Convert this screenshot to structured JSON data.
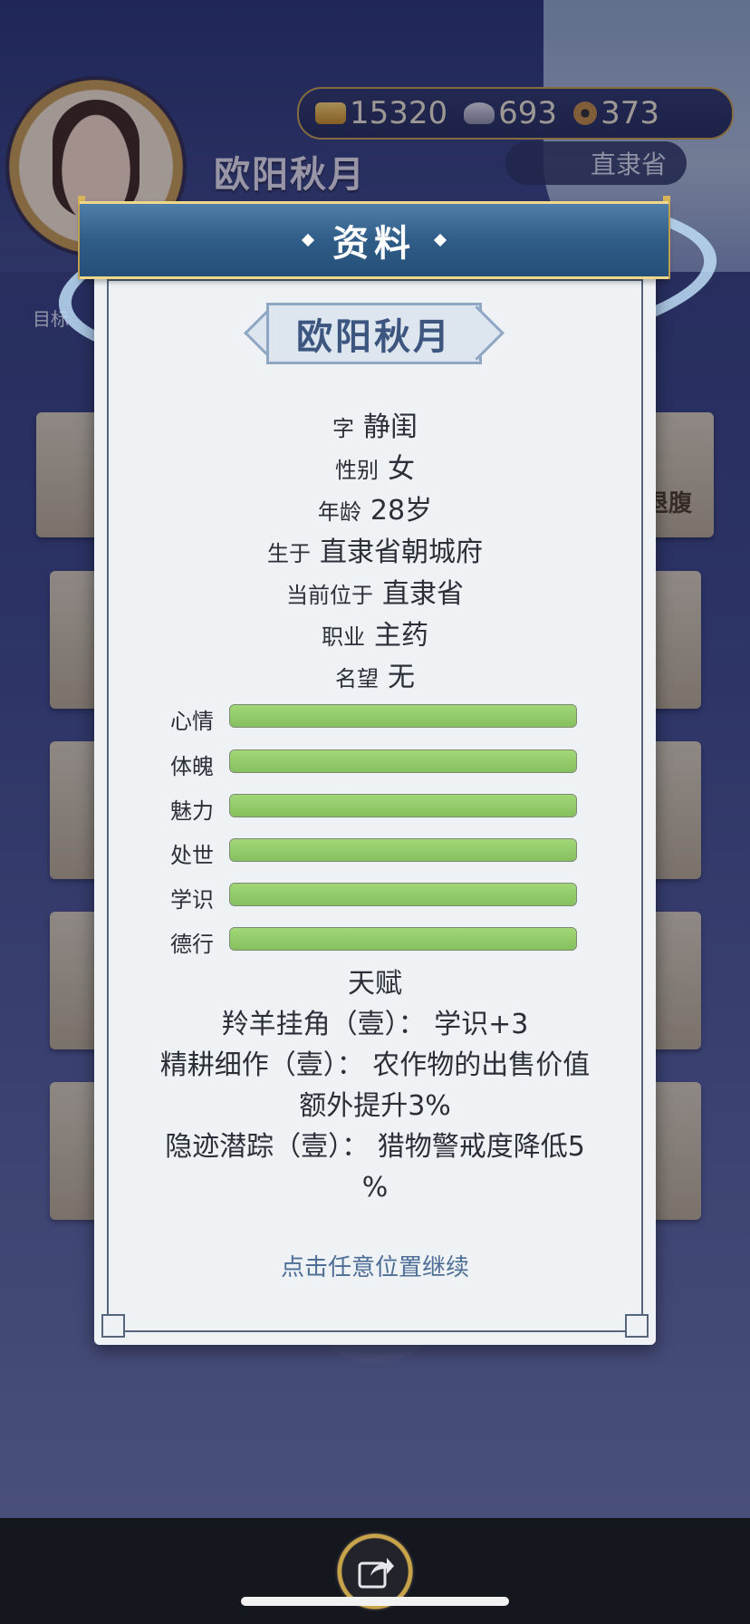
{
  "background": {
    "player_name": "欧阳秋月",
    "currency": {
      "gold": "15320",
      "silver": "693",
      "copper": "373"
    },
    "province": "直隶省",
    "menu_label": "目标",
    "side_tab_label": "退腹"
  },
  "dialog": {
    "title": "资料",
    "name": "欧阳秋月",
    "info": [
      {
        "key": "字",
        "value": "静闺"
      },
      {
        "key": "性别",
        "value": "女"
      },
      {
        "key": "年龄",
        "value": "28岁"
      },
      {
        "key": "生于",
        "value": "直隶省朝城府"
      },
      {
        "key": "当前位于",
        "value": "直隶省"
      },
      {
        "key": "职业",
        "value": "主药"
      },
      {
        "key": "名望",
        "value": "无"
      }
    ],
    "stats": [
      {
        "label": "心情",
        "fill": 1.0
      },
      {
        "label": "体魄",
        "fill": 1.0
      },
      {
        "label": "魅力",
        "fill": 1.0
      },
      {
        "label": "处世",
        "fill": 1.0
      },
      {
        "label": "学识",
        "fill": 1.0
      },
      {
        "label": "德行",
        "fill": 1.0
      }
    ],
    "talent_heading": "天赋",
    "talents": [
      "羚羊挂角（壹）： 学识+3",
      "精耕细作（壹）： 农作物的出售价值",
      "额外提升3%",
      "隐迹潜踪（壹）： 猎物警戒度降低5",
      "%"
    ],
    "hint": "点击任意位置继续"
  },
  "colors": {
    "bar_fill": "#8cc563",
    "banner": "#2f5d87",
    "accent_gold": "#d8b55b",
    "hint_text": "#4e6e97"
  }
}
